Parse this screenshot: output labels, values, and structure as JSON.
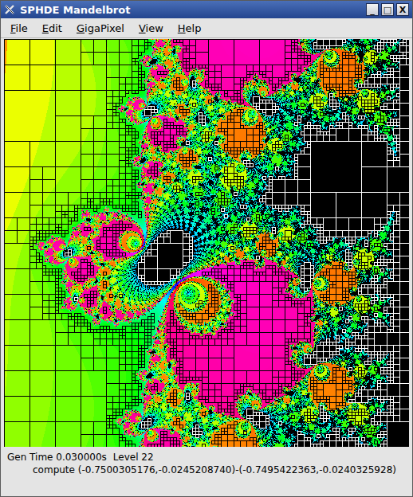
{
  "window": {
    "title": "SPHDE Mandelbrot",
    "controls": [
      "_",
      "□",
      "X"
    ]
  },
  "menu": [
    {
      "label": "File",
      "mnemonic": "F"
    },
    {
      "label": "Edit",
      "mnemonic": "E"
    },
    {
      "label": "GigaPixel",
      "mnemonic": "G"
    },
    {
      "label": "View",
      "mnemonic": "V"
    },
    {
      "label": "Help",
      "mnemonic": "H"
    }
  ],
  "status_bar": {
    "gen_time": "Gen Time 0.030000s",
    "level": "Level 22",
    "compute": "compute (-0.7500305176,-0.0245208740)-(-0.7495422363,-0.0240325928)"
  }
}
